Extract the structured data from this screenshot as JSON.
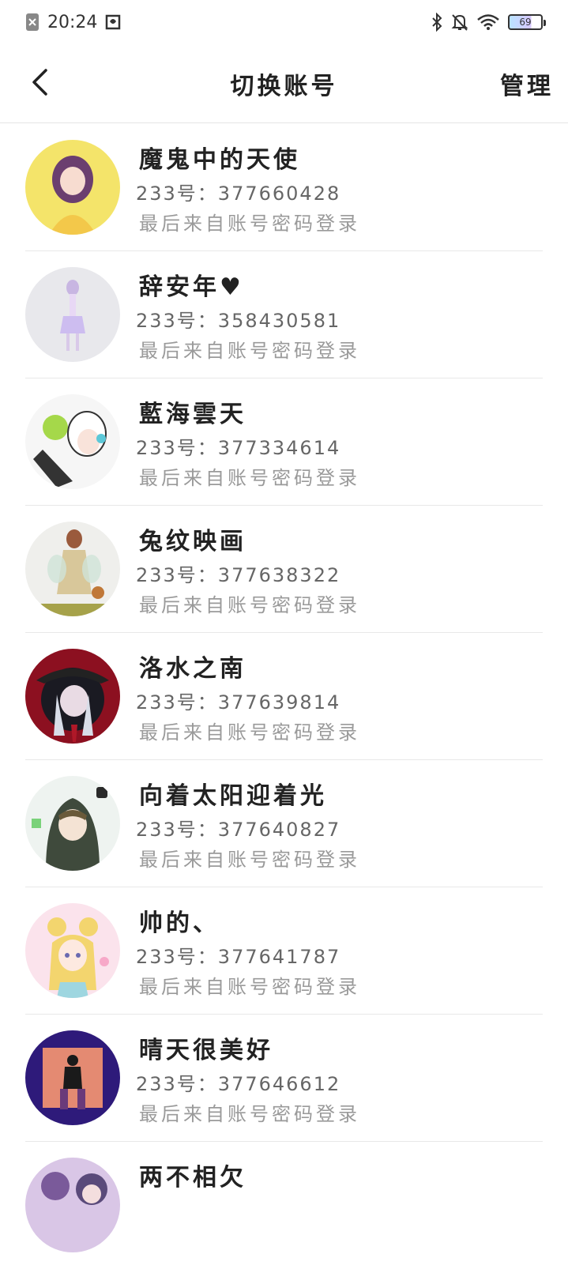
{
  "status_bar": {
    "time": "20:24",
    "battery_level": "69",
    "icons": [
      "notification-dismissed-icon",
      "screenshot-icon",
      "bluetooth-icon",
      "bell-off-icon",
      "wifi-icon",
      "battery-icon"
    ]
  },
  "header": {
    "title": "切换账号",
    "manage_label": "管理",
    "back_icon": "chevron-left-icon"
  },
  "accounts": [
    {
      "name": "魔鬼中的天使",
      "id_text": "233号：377660428",
      "login_text": "最后来自账号密码登录",
      "avatar_bg": "#f4e46a",
      "avatar_fg": "#8a5a8f"
    },
    {
      "name": "辞安年♥",
      "id_text": "233号：358430581",
      "login_text": "最后来自账号密码登录",
      "avatar_bg": "#e8e8ec",
      "avatar_fg": "#b9a4d8"
    },
    {
      "name": "藍海雲天",
      "id_text": "233号：377334614",
      "login_text": "最后来自账号密码登录",
      "avatar_bg": "#f6f6f6",
      "avatar_fg": "#9bd14a"
    },
    {
      "name": "兔纹映画",
      "id_text": "233号：377638322",
      "login_text": "最后来自账号密码登录",
      "avatar_bg": "#efefec",
      "avatar_fg": "#c9a77a"
    },
    {
      "name": "洛水之南",
      "id_text": "233号：377639814",
      "login_text": "最后来自账号密码登录",
      "avatar_bg": "#8c1020",
      "avatar_fg": "#2a2a3a"
    },
    {
      "name": "向着太阳迎着光",
      "id_text": "233号：377640827",
      "login_text": "最后来自账号密码登录",
      "avatar_bg": "#eef3f0",
      "avatar_fg": "#3f4a3c"
    },
    {
      "name": "帅的、",
      "id_text": "233号：377641787",
      "login_text": "最后来自账号密码登录",
      "avatar_bg": "#fbe3ec",
      "avatar_fg": "#f3d56e"
    },
    {
      "name": "晴天很美好",
      "id_text": "233号：377646612",
      "login_text": "最后来自账号密码登录",
      "avatar_bg": "#2e1a7a",
      "avatar_fg": "#e48a72"
    },
    {
      "name": "两不相欠",
      "id_text": "",
      "login_text": "",
      "avatar_bg": "#d9c6e6",
      "avatar_fg": "#7a5a9a"
    }
  ]
}
